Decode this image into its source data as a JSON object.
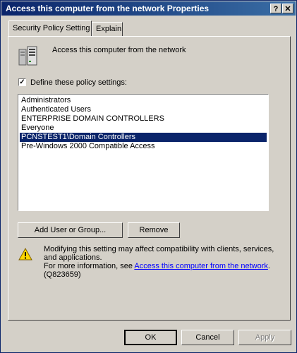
{
  "window": {
    "title": "Access this computer from the network Properties",
    "help_label": "?",
    "close_label": "✕"
  },
  "tabs": [
    {
      "label": "Security Policy Setting",
      "active": true
    },
    {
      "label": "Explain",
      "active": false
    }
  ],
  "policy": {
    "name": "Access this computer from the network"
  },
  "define_checkbox": {
    "label": "Define these policy settings:",
    "checked": true,
    "mark": "✓"
  },
  "members": [
    {
      "label": "Administrators",
      "selected": false
    },
    {
      "label": "Authenticated Users",
      "selected": false
    },
    {
      "label": "ENTERPRISE DOMAIN CONTROLLERS",
      "selected": false
    },
    {
      "label": "Everyone",
      "selected": false
    },
    {
      "label": "PCNSTEST1\\Domain Controllers",
      "selected": true
    },
    {
      "label": "Pre-Windows 2000 Compatible Access",
      "selected": false
    }
  ],
  "buttons": {
    "add_label": "Add User or Group...",
    "remove_label": "Remove",
    "ok_label": "OK",
    "cancel_label": "Cancel",
    "apply_label": "Apply"
  },
  "warning": {
    "line1": "Modifying this setting may affect compatibility with clients, services,",
    "line2": "and applications.",
    "line3_prefix": "For more information, see ",
    "link_text": "Access this computer from the network",
    "line3_suffix": ".",
    "line4": "(Q823659)"
  },
  "colors": {
    "titlebar": "#0a246a",
    "selection": "#0a246a",
    "link": "#0000ff",
    "face": "#d4d0c8"
  }
}
